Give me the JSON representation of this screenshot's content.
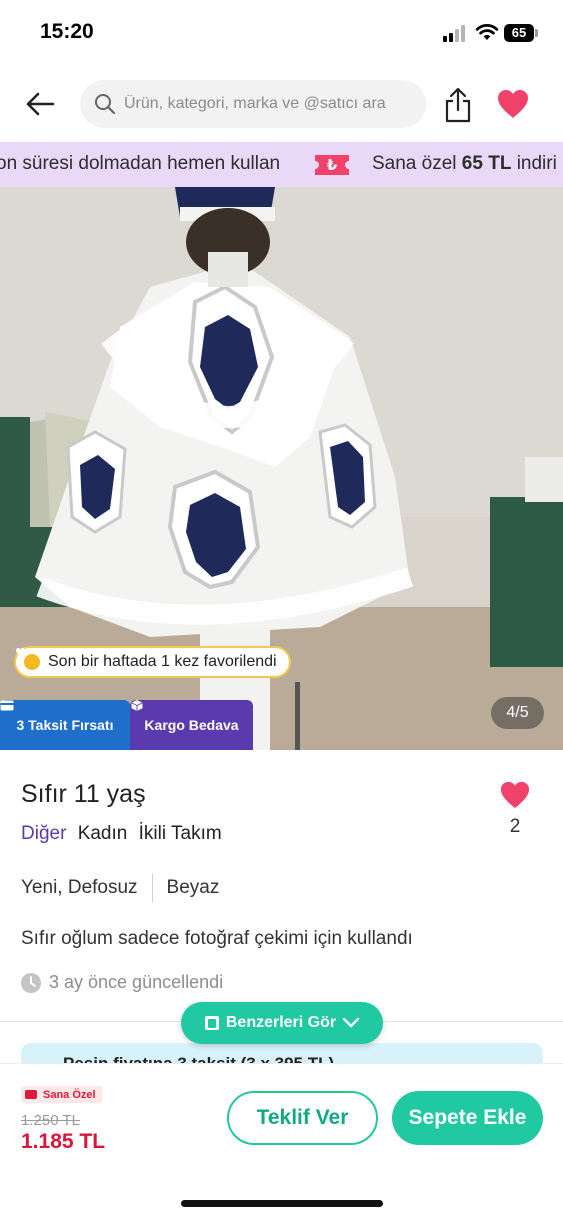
{
  "status_bar": {
    "time": "15:20",
    "battery": "65"
  },
  "header": {
    "search_placeholder": "Ürün, kategori, marka ve @satıcı ara"
  },
  "promo": {
    "left_text": "on süresi dolmadan hemen kullan",
    "right_prefix": "Sana özel",
    "right_amount": "65 TL",
    "right_suffix": "indiri"
  },
  "gallery": {
    "favorite_note": "Son bir haftada 1 kez favorilendi",
    "counter": "4/5",
    "badges": {
      "installment": "3 Taksit Fırsatı",
      "shipping": "Kargo Bedava"
    }
  },
  "product": {
    "title": "Sıfır 11 yaş",
    "like_count": "2",
    "brand": "Diğer",
    "category": "Kadın",
    "subcategory": "İkili Takım",
    "condition": "Yeni, Defosuz",
    "color": "Beyaz",
    "description": "Sıfır oğlum sadece fotoğraf çekimi için kullandı",
    "updated": "3 ay önce güncellendi"
  },
  "similar_button": "Benzerleri Gör",
  "installment_strip": "Peşin fiyatına 3 taksit (3 x 395 TL)",
  "bottom_bar": {
    "special_tag": "Sana Özel",
    "old_price": "1.250 TL",
    "new_price": "1.185 TL",
    "offer_button": "Teklif Ver",
    "cart_button": "Sepete Ekle"
  },
  "colors": {
    "accent": "#21c9a2",
    "heart": "#f0426a",
    "brand_purple": "#5b3ab0",
    "promo_bg": "#e9d8f7",
    "price_red": "#d9163a"
  }
}
